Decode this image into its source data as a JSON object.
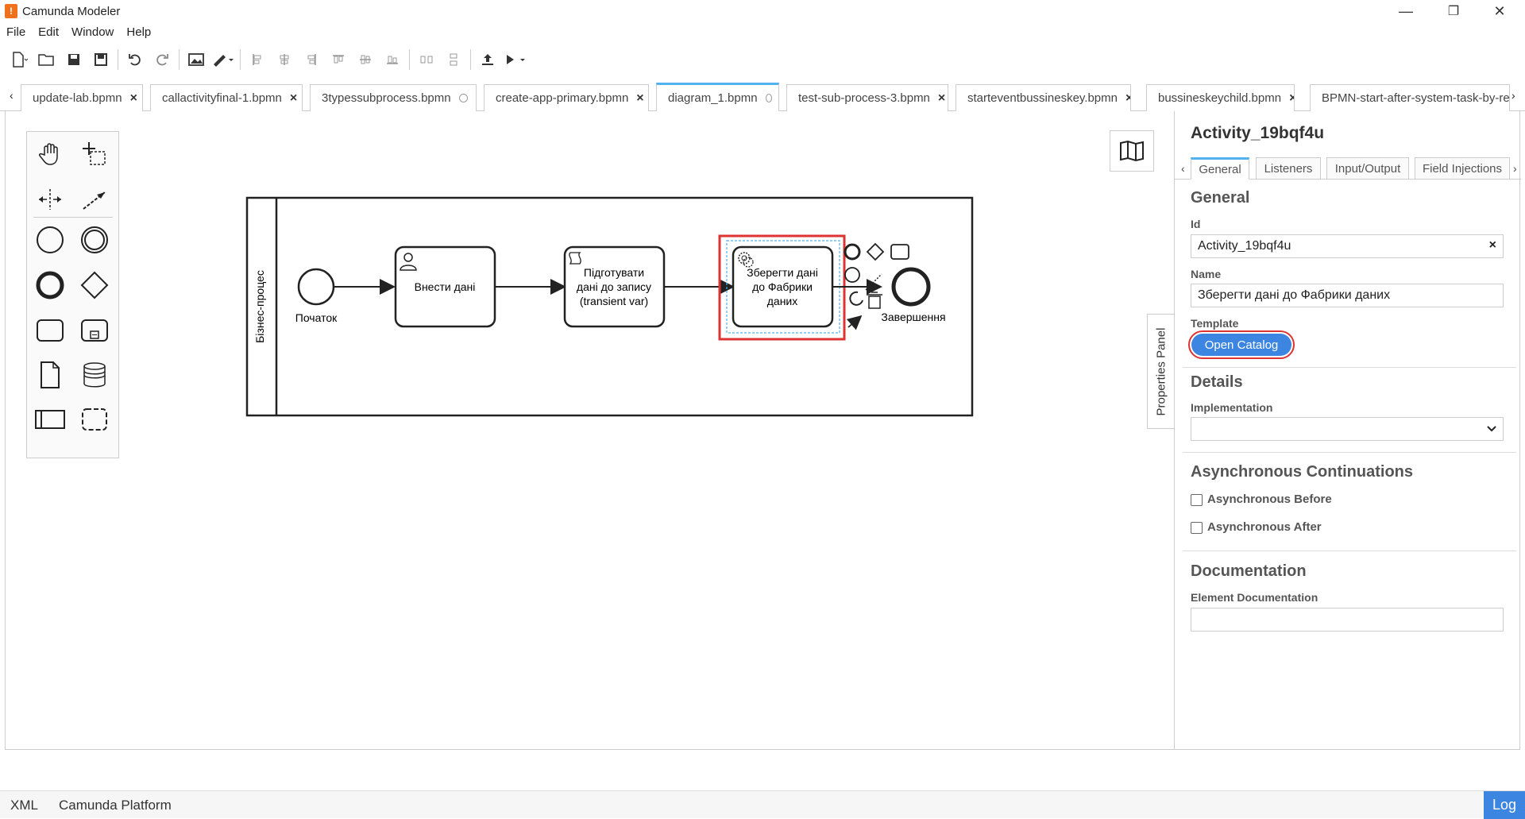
{
  "window": {
    "title": "Camunda Modeler",
    "app_icon": "camunda-icon",
    "minimize": "—",
    "maximize": "❐",
    "close": "✕"
  },
  "menu": [
    "File",
    "Edit",
    "Window",
    "Help"
  ],
  "tabs": [
    {
      "label": "update-lab.bpmn",
      "state": "close"
    },
    {
      "label": "callactivityfinal-1.bpmn",
      "state": "close"
    },
    {
      "label": "3typessubprocess.bpmn",
      "state": "dot"
    },
    {
      "label": "create-app-primary.bpmn",
      "state": "close"
    },
    {
      "label": "diagram_1.bpmn",
      "state": "dot",
      "active": true
    },
    {
      "label": "test-sub-process-3.bpmn",
      "state": "close"
    },
    {
      "label": "starteventbussineskey.bpmn",
      "state": "close"
    },
    {
      "label": "bussineskeychild.bpmn",
      "state": "close"
    },
    {
      "label": "BPMN-start-after-system-task-by-re",
      "state": "none"
    }
  ],
  "diagram": {
    "pool_label": "Бізнес-процес",
    "start_event": "Початок",
    "task1": "Внести дані",
    "task2_lines": [
      "Підготувати",
      "дані до запису",
      "(transient var)"
    ],
    "task3_lines": [
      "Зберегти дані",
      "до Фабрики",
      "даних"
    ],
    "end_event": "Завершення"
  },
  "properties_toggle": "Properties Panel",
  "props": {
    "title": "Activity_19bqf4u",
    "tabs": [
      "General",
      "Listeners",
      "Input/Output",
      "Field Injections"
    ],
    "general_title": "General",
    "id_label": "Id",
    "id_value": "Activity_19bqf4u",
    "name_label": "Name",
    "name_value": "Зберегти дані до Фабрики даних",
    "template_label": "Template",
    "open_catalog": "Open Catalog",
    "details_title": "Details",
    "implementation_label": "Implementation",
    "implementation_value": "",
    "async_title": "Asynchronous Continuations",
    "async_before": "Asynchronous Before",
    "async_after": "Asynchronous After",
    "doc_title": "Documentation",
    "doc_label": "Element Documentation"
  },
  "status": {
    "xml": "XML",
    "platform": "Camunda Platform",
    "log": "Log"
  },
  "colors": {
    "accent": "#52b2ef",
    "button": "#3c85e0",
    "highlight": "#d33"
  }
}
